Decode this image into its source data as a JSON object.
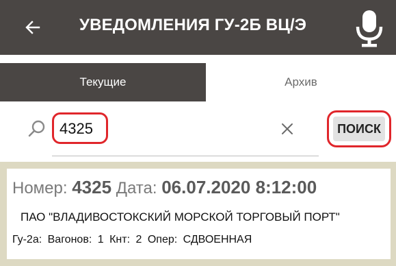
{
  "header": {
    "title": "УВЕДОМЛЕНИЯ ГУ-2Б ВЦ/Э",
    "back_icon": "arrow-left-icon",
    "mic_icon": "microphone-icon"
  },
  "tabs": [
    {
      "label": "Текущие",
      "active": true
    },
    {
      "label": "Архив",
      "active": false
    }
  ],
  "search": {
    "value": "4325",
    "button_label": "ПОИСК",
    "icons": {
      "search": "search-icon",
      "clear": "close-icon"
    }
  },
  "results": [
    {
      "number_label": "Номер:",
      "number": "4325",
      "date_label": "Дата:",
      "date": "06.07.2020 8:12:00",
      "company": "ПАО \"ВЛАДИВОСТОКСКИЙ МОРСКОЙ ТОРГОВЫЙ ПОРТ\"",
      "form_label": "Гу-2а:",
      "wagons_label": "Вагонов:",
      "wagons": "1",
      "knt_label": "Кнт:",
      "knt": "2",
      "oper_label": "Опер:",
      "oper": "СДВОЕННАЯ"
    }
  ],
  "colors": {
    "appbar": "#4a4644",
    "highlight_outline": "#e0262b",
    "list_background": "#ddd9c2"
  }
}
